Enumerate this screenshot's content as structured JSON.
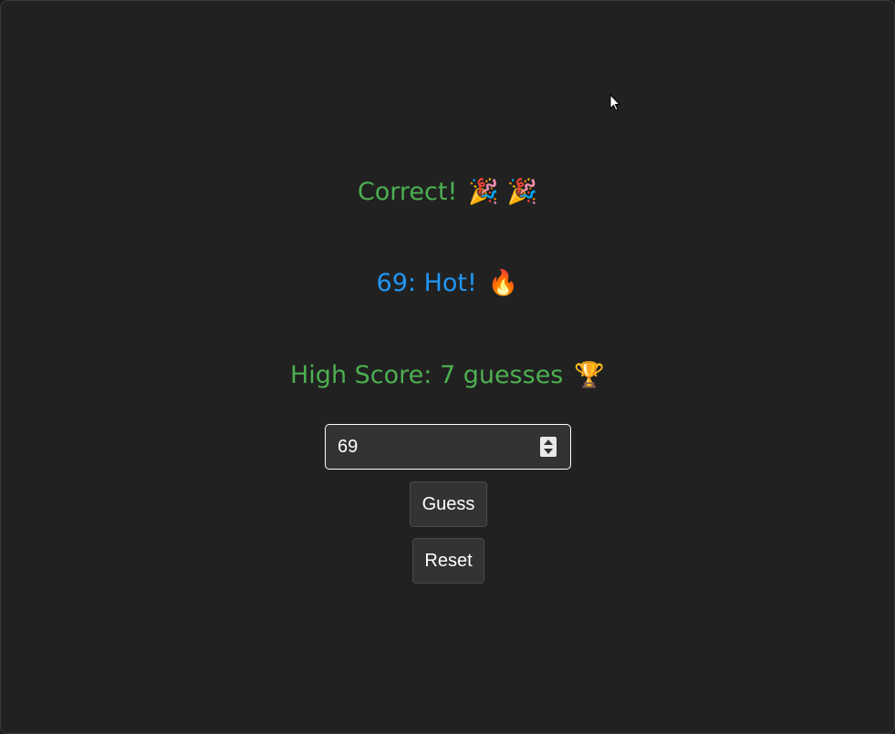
{
  "result": {
    "text": "Correct!",
    "emoji": "🎉 🎉",
    "color": "#4caf50"
  },
  "hint": {
    "text": "69: Hot!",
    "emoji": "🔥",
    "color": "#2196f3"
  },
  "high_score": {
    "text": "High Score: 7 guesses",
    "emoji": "🏆",
    "color": "#4caf50"
  },
  "guess_input": {
    "value": "69"
  },
  "buttons": {
    "guess_label": "Guess",
    "reset_label": "Reset"
  }
}
